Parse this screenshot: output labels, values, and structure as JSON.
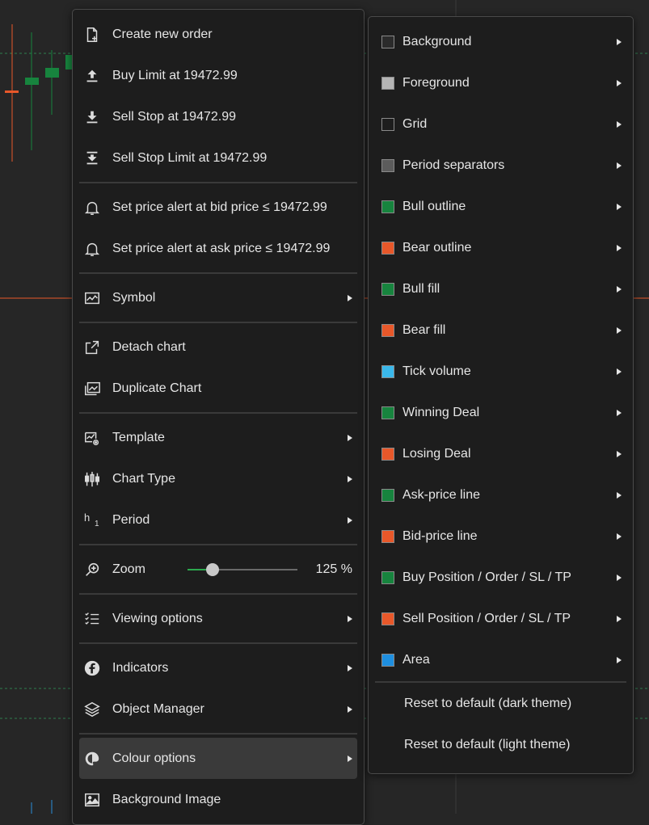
{
  "colors": {
    "bull": "#17843e",
    "bear": "#e8582a",
    "chart_bg": "#262626",
    "grid_dash": "#2e7d4f",
    "price_line": "#e8582a",
    "blue_line": "#2a8fd8"
  },
  "main_menu": {
    "create_order": "Create new order",
    "buy_limit": "Buy Limit at 19472.99",
    "sell_stop": "Sell Stop at 19472.99",
    "sell_stop_limit": "Sell Stop Limit at 19472.99",
    "alert_bid": "Set price alert at bid price ≤ 19472.99",
    "alert_ask": "Set price alert at ask price ≤ 19472.99",
    "symbol": "Symbol",
    "detach_chart": "Detach chart",
    "duplicate_chart": "Duplicate Chart",
    "template": "Template",
    "chart_type": "Chart Type",
    "period": "Period",
    "period_icon_h": "h",
    "period_icon_n": "1",
    "zoom": "Zoom",
    "zoom_value": "125 %",
    "zoom_fraction": 0.23,
    "viewing_options": "Viewing options",
    "indicators": "Indicators",
    "object_manager": "Object Manager",
    "colour_options": "Colour options",
    "background_image": "Background Image"
  },
  "colour_menu": {
    "items": [
      {
        "label": "Background",
        "color": "#2b2b2b"
      },
      {
        "label": "Foreground",
        "color": "#b4b4b4"
      },
      {
        "label": "Grid",
        "color": "#1d1d1d"
      },
      {
        "label": "Period separators",
        "color": "#5c5c5c"
      },
      {
        "label": "Bull outline",
        "color": "#17843e"
      },
      {
        "label": "Bear outline",
        "color": "#e8582a"
      },
      {
        "label": "Bull fill",
        "color": "#17843e"
      },
      {
        "label": "Bear fill",
        "color": "#e8582a"
      },
      {
        "label": "Tick volume",
        "color": "#3ab8ea"
      },
      {
        "label": "Winning Deal",
        "color": "#17843e"
      },
      {
        "label": "Losing Deal",
        "color": "#e8582a"
      },
      {
        "label": "Ask-price line",
        "color": "#17843e"
      },
      {
        "label": "Bid-price line",
        "color": "#e8582a"
      },
      {
        "label": "Buy Position / Order / SL / TP",
        "color": "#17843e"
      },
      {
        "label": "Sell Position / Order / SL / TP",
        "color": "#e8582a"
      },
      {
        "label": "Area",
        "color": "#1e8fe0"
      }
    ],
    "reset_dark": "Reset to default (dark theme)",
    "reset_light": "Reset to default (light theme)"
  }
}
